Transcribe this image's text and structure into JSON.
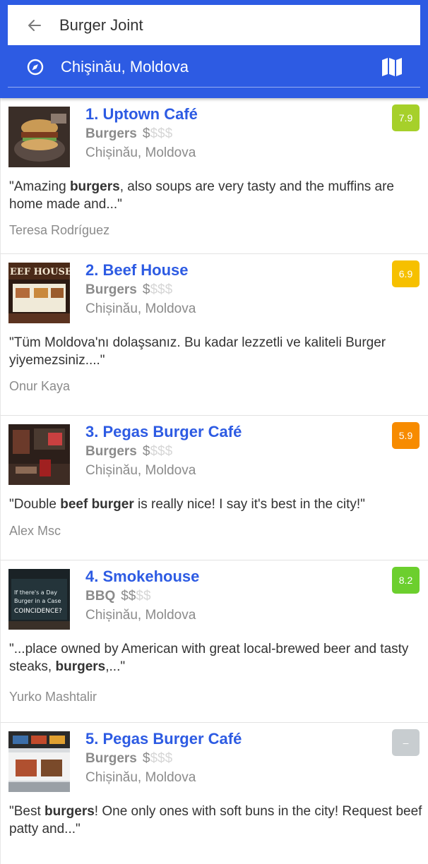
{
  "search": {
    "query": "Burger Joint"
  },
  "location": {
    "text": "Chişinău, Moldova"
  },
  "icons": {
    "back": "arrow-left-icon",
    "compass": "compass-icon",
    "map": "map-icon"
  },
  "colors": {
    "header": "#2d5be3",
    "name": "#2d5be3"
  },
  "venues": [
    {
      "name": "1. Uptown Café",
      "category": "Burgers",
      "price_active": "$",
      "price_inactive": "$$$",
      "city": "Chișinău, Moldova",
      "score": "7.9",
      "score_color": "#a6d02a",
      "quote_parts": [
        {
          "t": "\"Amazing ",
          "b": false
        },
        {
          "t": "burgers",
          "b": true
        },
        {
          "t": ",  also soups are very tasty  and the muffins are home made and...\"",
          "b": false
        }
      ],
      "author": "Teresa Rodríguez"
    },
    {
      "name": "2. Beef House",
      "category": "Burgers",
      "price_active": "$",
      "price_inactive": "$$$",
      "city": "Chișinău, Moldova",
      "score": "6.9",
      "score_color": "#f6c000",
      "quote_parts": [
        {
          "t": "\"Tüm Moldova'nı dolaşsanız. Bu kadar lezzetli ve kaliteli Burger yiyemezsiniz....\"",
          "b": false
        }
      ],
      "author": "Onur Kaya"
    },
    {
      "name": "3. Pegas Burger Café",
      "category": "Burgers",
      "price_active": "$",
      "price_inactive": "$$$",
      "city": "Chișinău, Moldova",
      "score": "5.9",
      "score_color": "#f78b00",
      "quote_parts": [
        {
          "t": "\"Double ",
          "b": false
        },
        {
          "t": "beef burger",
          "b": true
        },
        {
          "t": " is really nice! I say it's best in the city!\"",
          "b": false
        }
      ],
      "author": "Alex Msc"
    },
    {
      "name": "4. Smokehouse",
      "category": "BBQ",
      "price_active": "$$",
      "price_inactive": "$$",
      "city": "Chișinău, Moldova",
      "score": "8.2",
      "score_color": "#6ccf2e",
      "quote_parts": [
        {
          "t": "\"...place owned by American with great local-brewed beer and tasty steaks, ",
          "b": false
        },
        {
          "t": "burgers",
          "b": true
        },
        {
          "t": ",...\"",
          "b": false
        }
      ],
      "author": "Yurko Mashtalir"
    },
    {
      "name": "5. Pegas Burger Café",
      "category": "Burgers",
      "price_active": "$",
      "price_inactive": "$$$",
      "city": "Chișinău, Moldova",
      "score": "–",
      "score_color": "#c8cdd0",
      "quote_parts": [
        {
          "t": "\"Best ",
          "b": false
        },
        {
          "t": "burgers",
          "b": true
        },
        {
          "t": "! One only ones with soft buns in the city! Request beef patty and...\"",
          "b": false
        }
      ],
      "author": ""
    }
  ]
}
